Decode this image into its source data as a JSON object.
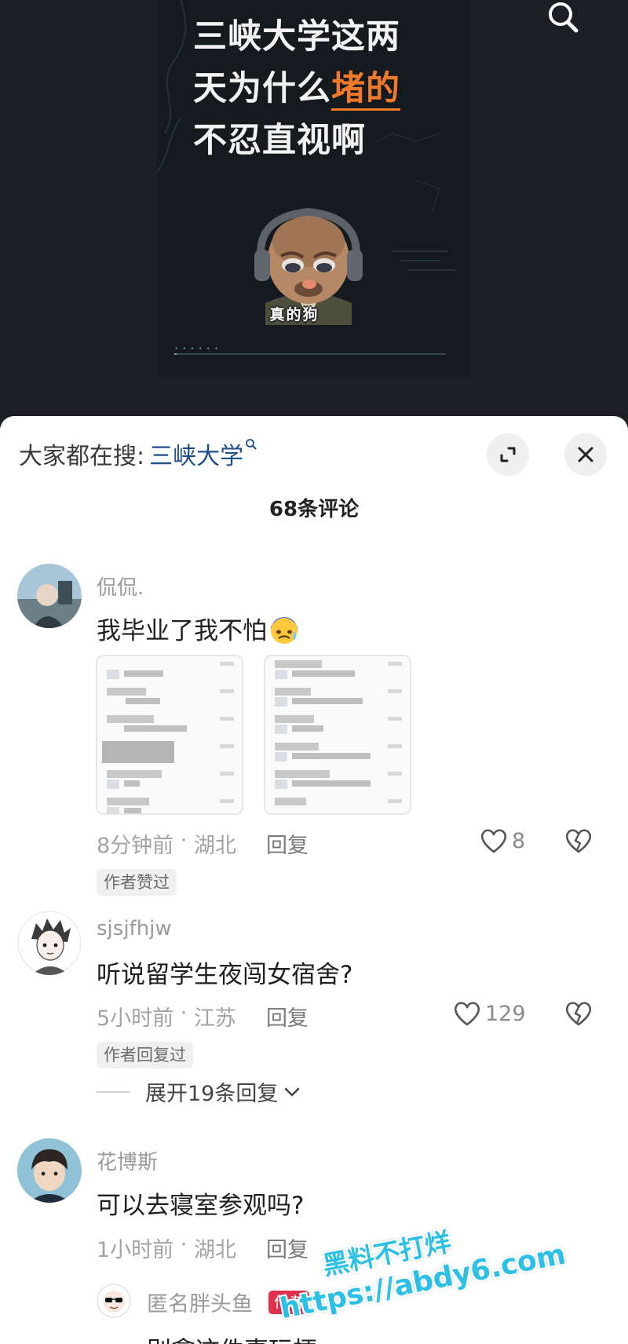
{
  "video": {
    "headline": {
      "line1": "三峡大学这两",
      "line2_before": "天为什么",
      "line2_highlight": "堵的",
      "line3": "不忍直视啊"
    },
    "sticker_caption": "真的狗",
    "progress_fraction": 0.01,
    "highlight_color": "#f07a2a",
    "search_icon": "search-icon"
  },
  "sheet": {
    "trending_label": "大家都在搜:",
    "trending_query": "三峡大学",
    "comment_count_title": "68条评论",
    "expand_icon": "expand-icon",
    "close_icon": "close-icon"
  },
  "comments": [
    {
      "username": "侃侃.",
      "content": "我毕业了我不怕",
      "emoji_icon": "sweating-face-emoji-icon",
      "time": "8分钟前",
      "location": "湖北",
      "reply_label": "回复",
      "likes": "8",
      "badge": "作者赞过"
    },
    {
      "username": "sjsjfhjw",
      "content": "听说留学生夜闯女宿舍?",
      "time": "5小时前",
      "location": "江苏",
      "reply_label": "回复",
      "likes": "129",
      "badge": "作者回复过",
      "expand_replies": "展开19条回复"
    },
    {
      "username": "花博斯",
      "content": "可以去寝室参观吗?",
      "time": "1小时前",
      "location": "湖北",
      "reply_label": "回复"
    }
  ],
  "sub_reply": {
    "username": "匿名胖头鱼",
    "author_tag": "作者",
    "content": "别拿这件事玩梗"
  },
  "watermark": {
    "line1": "黑料不打烊",
    "line2": "https://abdy6.com",
    "color": "#2cc0e6"
  }
}
